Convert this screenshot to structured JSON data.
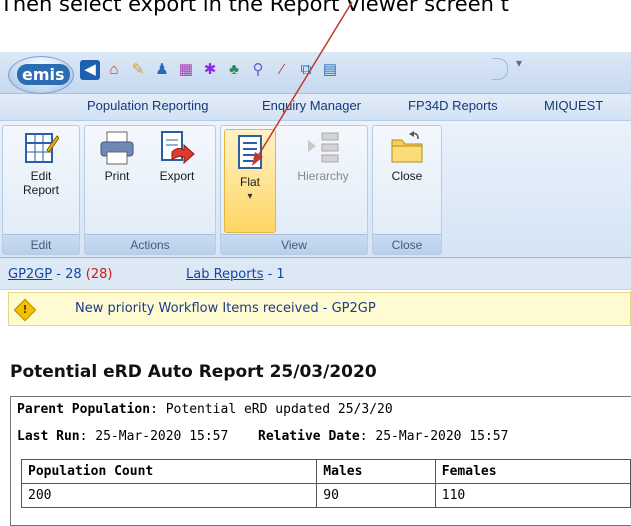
{
  "caption": "Then select export in the Report Viewer screen t",
  "app": {
    "orb_label": "emis"
  },
  "qat": {
    "icons": [
      "back-icon",
      "home-icon",
      "pencil-icon",
      "users-icon",
      "calendar-icon",
      "cross-icon",
      "people-icon",
      "magnifier-icon",
      "wand-icon",
      "preview-icon",
      "grid-icon"
    ],
    "dropdown": "▾"
  },
  "menu": {
    "items": [
      "Population Reporting",
      "Enquiry Manager",
      "FP34D Reports",
      "MIQUEST"
    ]
  },
  "ribbon": {
    "groups": {
      "edit": {
        "label": "Edit",
        "buttons": {
          "edit_report": "Edit\nReport"
        }
      },
      "actions": {
        "label": "Actions",
        "buttons": {
          "print": "Print",
          "export": "Export"
        }
      },
      "view": {
        "label": "View",
        "buttons": {
          "flat": "Flat",
          "hierarchy": "Hierarchy"
        }
      },
      "close": {
        "label": "Close",
        "buttons": {
          "close": "Close"
        }
      }
    }
  },
  "status": {
    "gp2gp_link": "GP2GP",
    "gp2gp_count": " - 28 ",
    "gp2gp_alert": "(28)",
    "lab_link": "Lab Reports",
    "lab_count": " - 1"
  },
  "warning": {
    "text": "New priority Workflow Items received - GP2GP"
  },
  "report": {
    "title": "Potential eRD Auto Report 25/03/2020",
    "parent_population_label": "Parent Population",
    "parent_population_value": ": Potential eRD updated 25/3/20",
    "last_run_label": "Last Run",
    "last_run_value": ": 25-Mar-2020 15:57",
    "relative_date_label": "Relative Date",
    "relative_date_value": ": 25-Mar-2020 15:57",
    "table": {
      "headers": [
        "Population Count",
        "Males",
        "Females"
      ],
      "rows": [
        [
          "200",
          "90",
          "110"
        ]
      ]
    }
  },
  "colors": {
    "accent_arrow": "#c0392b",
    "link": "#1245a8",
    "alert": "#d01818"
  }
}
